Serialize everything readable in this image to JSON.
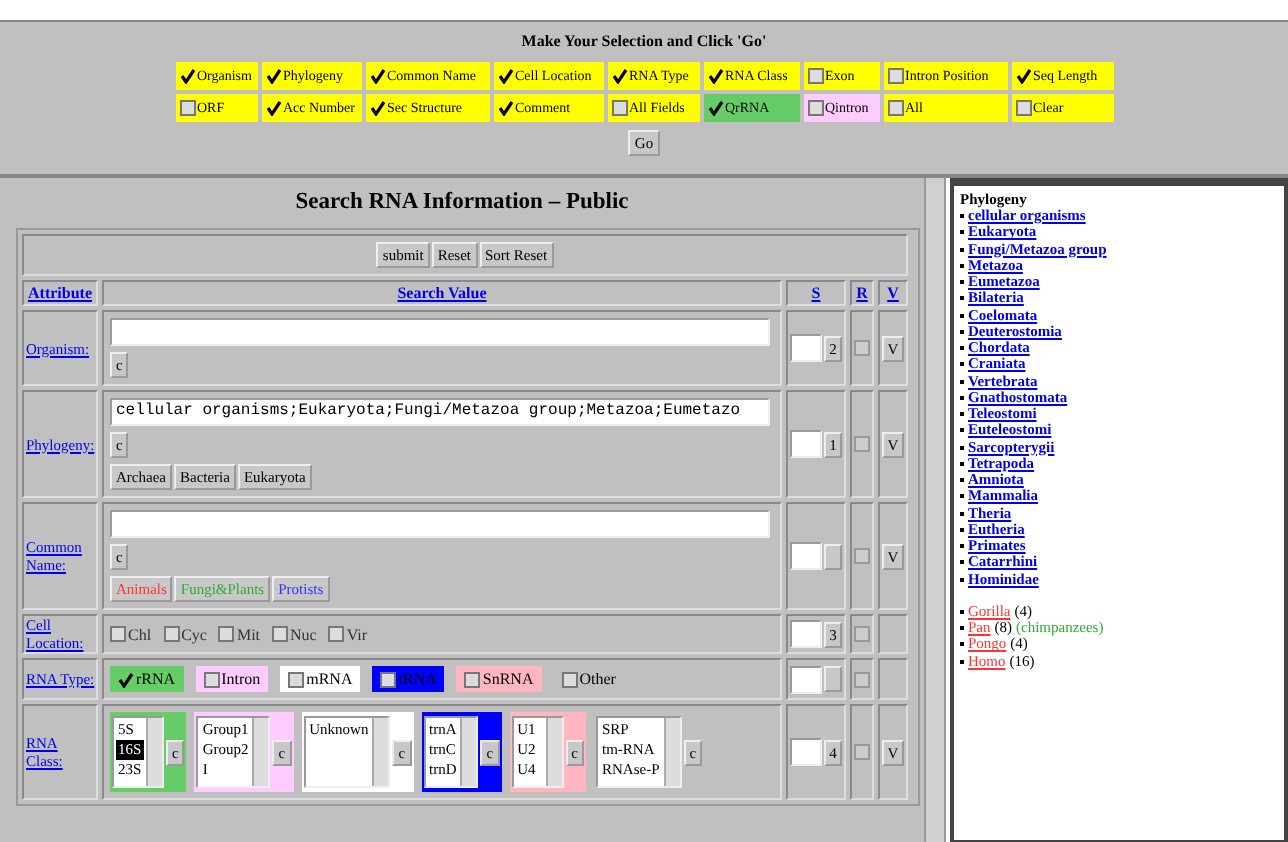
{
  "selection_panel": {
    "title": "Make Your Selection and Click 'Go'",
    "options": [
      {
        "label": "Organism",
        "checked": true,
        "color": "#ffff00"
      },
      {
        "label": "Phylogeny",
        "checked": true,
        "color": "#ffff00"
      },
      {
        "label": "Common Name",
        "checked": true,
        "color": "#ffff00"
      },
      {
        "label": "Cell Location",
        "checked": true,
        "color": "#ffff00"
      },
      {
        "label": "RNA Type",
        "checked": true,
        "color": "#ffff00"
      },
      {
        "label": "RNA Class",
        "checked": true,
        "color": "#ffff00"
      },
      {
        "label": "Exon",
        "checked": false,
        "color": "#ffff00"
      },
      {
        "label": "Intron Position",
        "checked": false,
        "color": "#ffff00"
      },
      {
        "label": "Seq Length",
        "checked": true,
        "color": "#ffff00"
      },
      {
        "label": "ORF",
        "checked": false,
        "color": "#ffff00"
      },
      {
        "label": "Acc Number",
        "checked": true,
        "color": "#ffff00"
      },
      {
        "label": "Sec Structure",
        "checked": true,
        "color": "#ffff00"
      },
      {
        "label": "Comment",
        "checked": true,
        "color": "#ffff00"
      },
      {
        "label": "All Fields",
        "checked": false,
        "color": "#ffff00"
      },
      {
        "label": "QrRNA",
        "checked": true,
        "color": "#66cc66"
      },
      {
        "label": "Qintron",
        "checked": false,
        "color": "#ffccff"
      },
      {
        "label": "All",
        "checked": false,
        "color": "#ffff00"
      },
      {
        "label": "Clear",
        "checked": false,
        "color": "#ffff00"
      }
    ],
    "go_button": "Go"
  },
  "search_panel": {
    "title": "Search RNA Information – Public",
    "buttons": [
      "submit",
      "Reset",
      "Sort Reset"
    ],
    "columns": [
      "Attribute",
      "Search Value",
      "S",
      "R",
      "V"
    ],
    "rows": [
      {
        "kind": "text",
        "label": "Organism:",
        "clear_button": "c",
        "sort_button": "2",
        "r_checked": false,
        "view_button": "V"
      },
      {
        "kind": "text",
        "label": "Phylogeny:",
        "value": "cellular organisms;Eukaryota;Fungi/Metazoa group;Metazoa;Eumetazo",
        "clear_button": "c",
        "presets": [
          {
            "label": "Archaea"
          },
          {
            "label": "Bacteria"
          },
          {
            "label": "Eukaryota"
          }
        ],
        "sort_button": "1",
        "r_checked": false,
        "view_button": "V"
      },
      {
        "kind": "text",
        "label": "Common Name:",
        "clear_button": "c",
        "presets": [
          {
            "label": "Animals",
            "color": "#ff3333"
          },
          {
            "label": "Fungi&Plants",
            "color": "#33aa33"
          },
          {
            "label": "Protists",
            "color": "#3333ff"
          }
        ],
        "r_checked": false,
        "view_button": "V"
      },
      {
        "kind": "checkboxes",
        "label": "Cell Location:",
        "options": [
          {
            "label": "Chl",
            "checked": false
          },
          {
            "label": "Cyc",
            "checked": false
          },
          {
            "label": "Mit",
            "checked": false
          },
          {
            "label": "Nuc",
            "checked": false
          },
          {
            "label": "Vir",
            "checked": false
          }
        ],
        "sort_button": "3",
        "r_checked": false
      },
      {
        "kind": "types",
        "label": "RNA Type:",
        "types": [
          {
            "label": "rRNA",
            "checked": true,
            "color": "#66cc66"
          },
          {
            "label": "Intron",
            "checked": false,
            "color": "#ffccff"
          },
          {
            "label": "mRNA",
            "checked": false,
            "color": "#ffffff"
          },
          {
            "label": "tRNA",
            "checked": false,
            "color": "#0000ff"
          },
          {
            "label": "SnRNA",
            "checked": false,
            "color": "#ffb6c1"
          },
          {
            "label": "Other",
            "checked": false,
            "color": "#c0c0c0"
          }
        ],
        "r_checked": false
      },
      {
        "kind": "classes",
        "label": "RNA Class:",
        "groups": [
          {
            "color": "#66cc66",
            "items": [
              {
                "label": "5S",
                "selected": false
              },
              {
                "label": "16S",
                "selected": true
              },
              {
                "label": "23S",
                "selected": false
              }
            ],
            "button": "c"
          },
          {
            "color": "#ffccff",
            "items": [
              {
                "label": "Group1",
                "selected": false
              },
              {
                "label": "Group2",
                "selected": false
              },
              {
                "label": "I",
                "selected": false
              }
            ],
            "button": "c"
          },
          {
            "color": "#ffffff",
            "items": [
              {
                "label": "Unknown",
                "selected": false
              }
            ],
            "button": "c"
          },
          {
            "color": "#0000ff",
            "items": [
              {
                "label": "trnA",
                "selected": false
              },
              {
                "label": "trnC",
                "selected": false
              },
              {
                "label": "trnD",
                "selected": false
              }
            ],
            "button": "c"
          },
          {
            "color": "#ffb6c1",
            "items": [
              {
                "label": "U1",
                "selected": false
              },
              {
                "label": "U2",
                "selected": false
              },
              {
                "label": "U4",
                "selected": false
              }
            ],
            "button": "c"
          },
          {
            "color": "#c0c0c0",
            "items": [
              {
                "label": "SRP",
                "selected": false
              },
              {
                "label": "tm-RNA",
                "selected": false
              },
              {
                "label": "RNAse-P",
                "selected": false
              }
            ],
            "button": "c"
          }
        ],
        "sort_button": "4",
        "r_checked": false,
        "view_button": "V"
      }
    ]
  },
  "phylogeny_panel": {
    "title": "Phylogeny",
    "links": [
      "cellular organisms",
      "Eukaryota",
      "Fungi/Metazoa group",
      "Metazoa",
      "Eumetazoa",
      "Bilateria",
      "Coelomata",
      "Deuterostomia",
      "Chordata",
      "Craniata",
      "Vertebrata",
      "Gnathostomata",
      "Teleostomi",
      "Euteleostomi",
      "Sarcopterygii",
      "Tetrapoda",
      "Amniota",
      "Mammalia",
      "Theria",
      "Eutheria",
      "Primates",
      "Catarrhini",
      "Hominidae"
    ],
    "genera": [
      {
        "name": "Gorilla",
        "count": "(4)"
      },
      {
        "name": "Pan",
        "count": "(8)",
        "note": "(chimpanzees)"
      },
      {
        "name": "Pongo",
        "count": "(4)"
      },
      {
        "name": "Homo",
        "count": "(16)"
      }
    ]
  }
}
